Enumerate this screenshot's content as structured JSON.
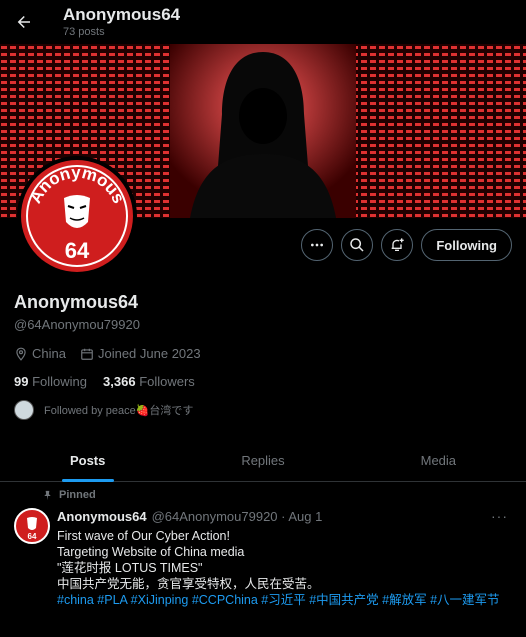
{
  "header": {
    "title": "Anonymous64",
    "posts_count": "73 posts"
  },
  "avatar": {
    "text_top": "Anonymous",
    "text_bottom": "64"
  },
  "actions": {
    "follow_label": "Following"
  },
  "profile": {
    "name": "Anonymous64",
    "handle": "@64Anonymou79920",
    "location": "China",
    "joined": "Joined June 2023",
    "following_count": "99",
    "following_label": "Following",
    "followers_count": "3,366",
    "followers_label": "Followers",
    "followed_by": "Followed by peace🍓台湾です"
  },
  "tabs": [
    {
      "label": "Posts"
    },
    {
      "label": "Replies"
    },
    {
      "label": "Media"
    }
  ],
  "post": {
    "pinned_label": "Pinned",
    "author": "Anonymous64",
    "handle_time": "@64Anonymou79920 · Aug 1",
    "lines": [
      "First wave of Our Cyber Action!",
      "Targeting Website of China media",
      "\"莲花时报 LOTUS TIMES\"",
      "中国共产党无能，贪官享受特权，人民在受苦。"
    ],
    "hashtags": "#china #PLA #XiJinping #CCPChina #习近平 #中国共产党 #解放军 #八一建军节"
  },
  "colors": {
    "accent": "#1d9bf0",
    "avatar_red": "#cf1e1e",
    "muted": "#71767b"
  }
}
